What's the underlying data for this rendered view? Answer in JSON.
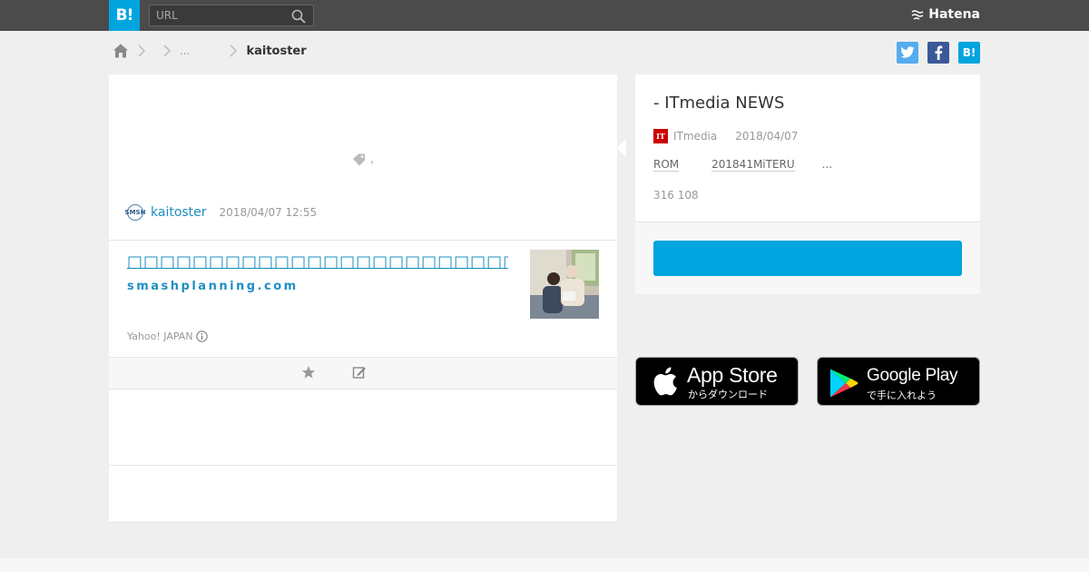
{
  "header": {
    "logo_text": "B!",
    "search_placeholder": "URL",
    "brand": "Hatena"
  },
  "breadcrumb": {
    "ellipsis": "...",
    "current": "kaitoster"
  },
  "share": {
    "twitter": "t",
    "facebook": "f",
    "hatena": "B!"
  },
  "bookmark": {
    "tag_text": ",",
    "user": "kaitoster",
    "avatar_text": "SMSH",
    "date": "2018/04/07 12:55",
    "entry_title": "□□□□□□□□□□□□□□□□□□□□□□□□",
    "entry_domain": "smashplanning.com",
    "provider": "Yahoo! JAPAN"
  },
  "entry": {
    "title": "- ITmedia NEWS",
    "site_logo": "IT",
    "site": "ITmedia",
    "date": "2018/04/07",
    "desc_1": "ROM",
    "desc_2": "201841MiTERU",
    "desc_3": "...",
    "count": "316 108"
  },
  "apps": {
    "appstore_big": "App Store",
    "appstore_small": "からダウンロード",
    "gplay_big": "Google Play",
    "gplay_small": "で手に入れよう"
  },
  "colors": {
    "hatena_blue": "#00a4de",
    "topbar": "#4b4b4b",
    "link": "#1d8fc4"
  }
}
